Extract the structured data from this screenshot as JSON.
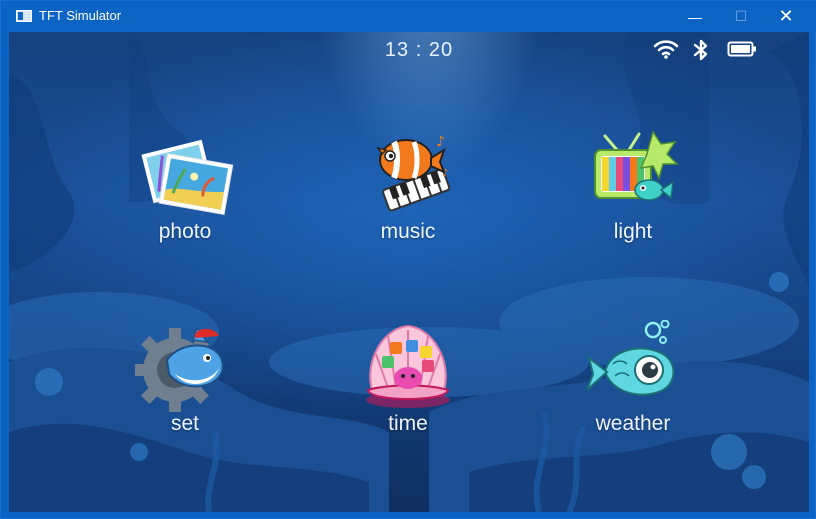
{
  "window": {
    "title": "TFT Simulator",
    "minimize_glyph": "—",
    "maximize_glyph": "☐",
    "close_glyph": "✕"
  },
  "statusbar": {
    "time": "13 : 20",
    "icons": [
      "wifi-icon",
      "bluetooth-icon",
      "battery-icon"
    ]
  },
  "apps": [
    {
      "label": "photo",
      "icon": "photo-icon"
    },
    {
      "label": "music",
      "icon": "music-clownfish-icon"
    },
    {
      "label": "light",
      "icon": "tv-fish-icon"
    },
    {
      "label": "set",
      "icon": "gear-shark-icon"
    },
    {
      "label": "time",
      "icon": "shell-octopus-icon"
    },
    {
      "label": "weather",
      "icon": "fish-eye-icon"
    }
  ],
  "colors": {
    "titlebar": "#0b63c4",
    "ocean_deep": "#0f2f60",
    "ocean_mid": "#1a4f98",
    "label_text": "#eef4ff"
  }
}
